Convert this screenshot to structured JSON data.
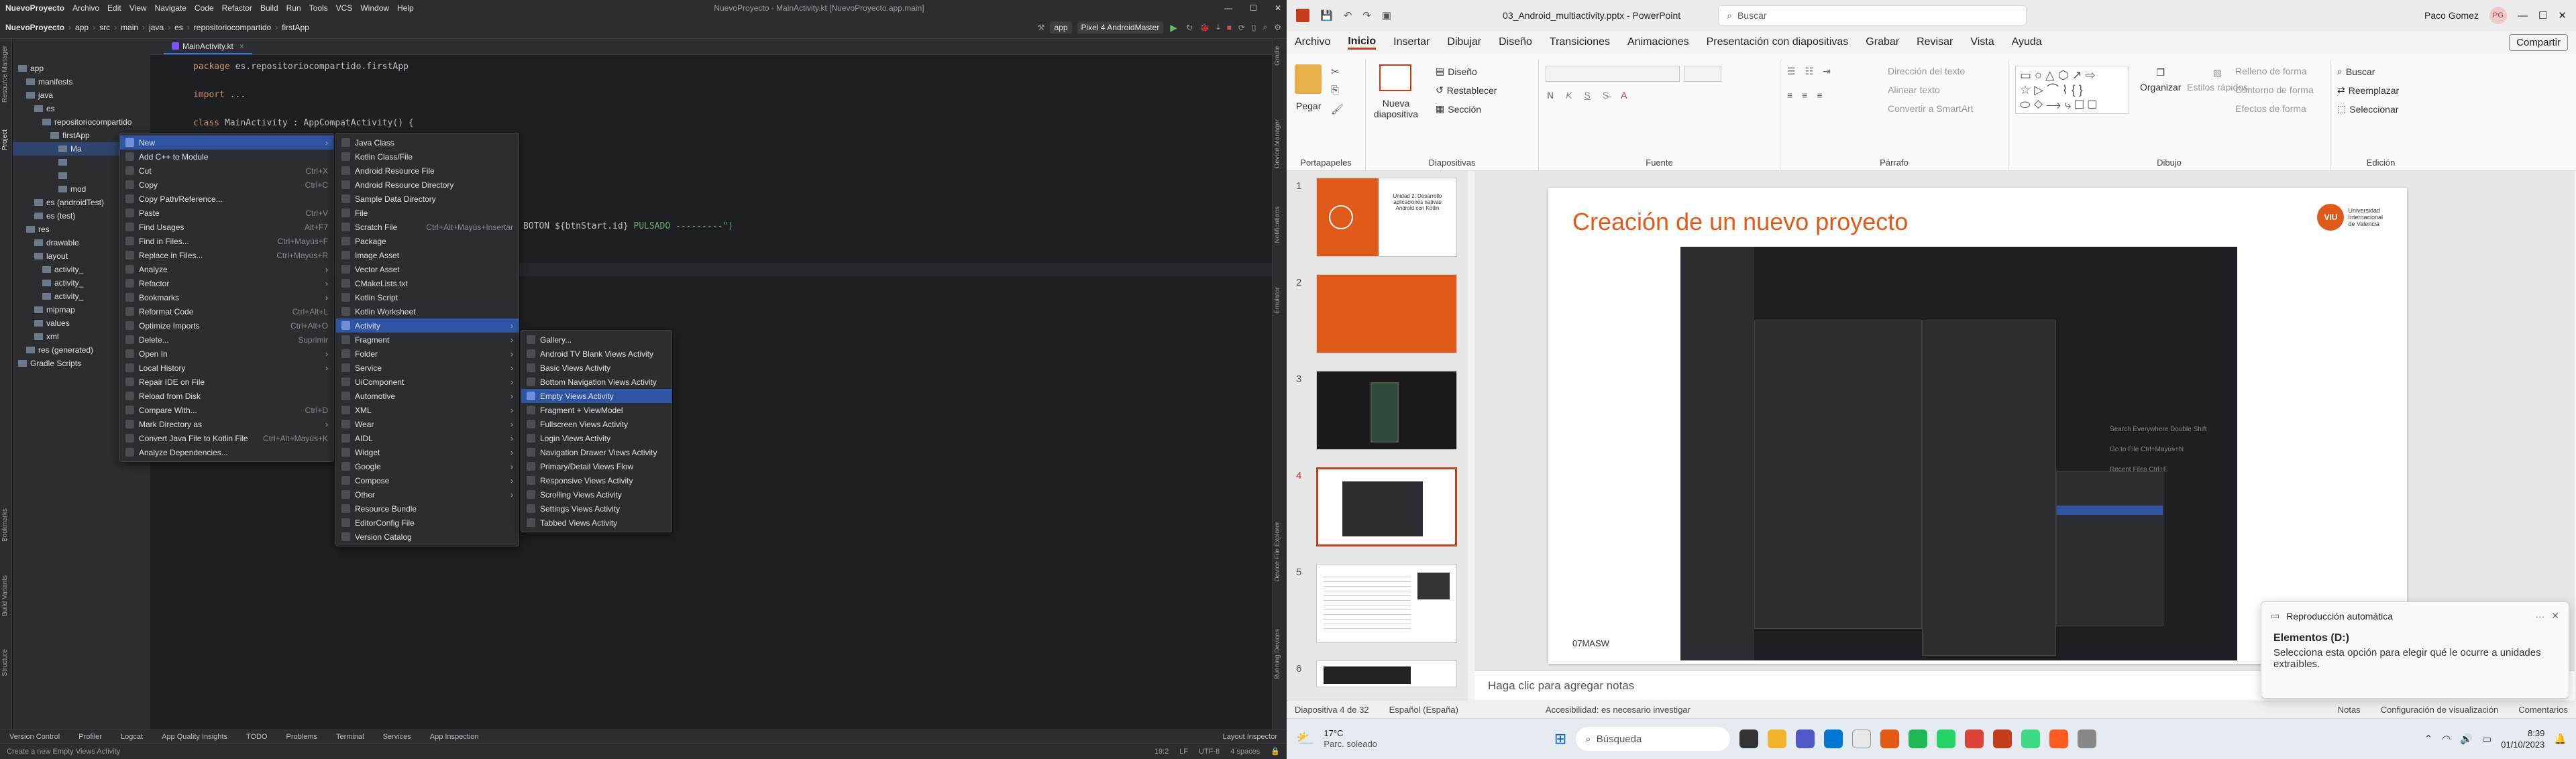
{
  "ide": {
    "title_menus": [
      "NuevoProyecto",
      "Archivo",
      "Edit",
      "View",
      "Navigate",
      "Code",
      "Refactor",
      "Build",
      "Run",
      "Tools",
      "VCS",
      "Window",
      "Help"
    ],
    "window_title": "NuevoProyecto - MainActivity.kt [NuevoProyecto.app.main]",
    "breadcrumbs": [
      "NuevoProyecto",
      "app",
      "src",
      "main",
      "java",
      "es",
      "repositoriocompartido",
      "firstApp"
    ],
    "run_config": "app",
    "device": "Pixel 4 AndroidMaster",
    "left_tool_labels": [
      "Resource Manager",
      "Project",
      "Bookmarks",
      "Build Variants",
      "Structure"
    ],
    "right_tool_labels": [
      "Gradle",
      "Device Manager",
      "Notifications",
      "Emulator",
      "Device File Explorer",
      "Running Devices"
    ],
    "tree": [
      {
        "label": "app",
        "indent": 0
      },
      {
        "label": "manifests",
        "indent": 1
      },
      {
        "label": "java",
        "indent": 1
      },
      {
        "label": "es",
        "indent": 2
      },
      {
        "label": "repositoriocompartido",
        "indent": 3
      },
      {
        "label": "firstApp",
        "indent": 4
      },
      {
        "label": "Ma",
        "indent": 5,
        "selected": true
      },
      {
        "label": "",
        "indent": 5
      },
      {
        "label": "",
        "indent": 5
      },
      {
        "label": "mod",
        "indent": 5
      },
      {
        "label": "es (androidTest)",
        "indent": 2
      },
      {
        "label": "es (test)",
        "indent": 2
      },
      {
        "label": "res",
        "indent": 1
      },
      {
        "label": "drawable",
        "indent": 2
      },
      {
        "label": "layout",
        "indent": 2
      },
      {
        "label": "activity_",
        "indent": 3
      },
      {
        "label": "activity_",
        "indent": 3
      },
      {
        "label": "activity_",
        "indent": 3
      },
      {
        "label": "mipmap",
        "indent": 2
      },
      {
        "label": "values",
        "indent": 2
      },
      {
        "label": "xml",
        "indent": 2
      },
      {
        "label": "res (generated)",
        "indent": 1
      },
      {
        "label": "Gradle Scripts",
        "indent": 0
      }
    ],
    "editor_tab": "MainActivity.kt",
    "code": {
      "line1_kw": "package",
      "line1_rest": " es.repositoriocompartido.firstApp",
      "line2_kw": "import",
      "line2_rest": " ...",
      "line3_kw": "class",
      "line3_rest": " MainActivity : AppCompatActivity() {",
      "line4_tx": "BOTON ${btnStart.id} ",
      "line4_str": "PULSADO ---------\")"
    },
    "menu1": [
      {
        "label": "New",
        "arrow": true,
        "hi": true
      },
      {
        "label": "Add C++ to Module"
      },
      {
        "label": "Cut",
        "sc": "Ctrl+X"
      },
      {
        "label": "Copy",
        "sc": "Ctrl+C"
      },
      {
        "label": "Copy Path/Reference..."
      },
      {
        "label": "Paste",
        "sc": "Ctrl+V"
      },
      {
        "label": "Find Usages",
        "sc": "Alt+F7"
      },
      {
        "label": "Find in Files...",
        "sc": "Ctrl+Mayús+F"
      },
      {
        "label": "Replace in Files...",
        "sc": "Ctrl+Mayús+R"
      },
      {
        "label": "Analyze",
        "arrow": true
      },
      {
        "label": "Refactor",
        "arrow": true
      },
      {
        "label": "Bookmarks",
        "arrow": true
      },
      {
        "label": "Reformat Code",
        "sc": "Ctrl+Alt+L"
      },
      {
        "label": "Optimize Imports",
        "sc": "Ctrl+Alt+O"
      },
      {
        "label": "Delete...",
        "sc": "Suprimir"
      },
      {
        "label": "Open In",
        "arrow": true
      },
      {
        "label": "Local History",
        "arrow": true
      },
      {
        "label": "Repair IDE on File"
      },
      {
        "label": "Reload from Disk"
      },
      {
        "label": "Compare With...",
        "sc": "Ctrl+D"
      },
      {
        "label": "Mark Directory as",
        "arrow": true
      },
      {
        "label": "Convert Java File to Kotlin File",
        "sc": "Ctrl+Alt+Mayús+K"
      },
      {
        "label": "Analyze Dependencies..."
      }
    ],
    "menu2": [
      {
        "label": "Java Class"
      },
      {
        "label": "Kotlin Class/File"
      },
      {
        "label": "Android Resource File"
      },
      {
        "label": "Android Resource Directory"
      },
      {
        "label": "Sample Data Directory"
      },
      {
        "label": "File"
      },
      {
        "label": "Scratch File",
        "sc": "Ctrl+Alt+Mayús+Insertar"
      },
      {
        "label": "Package"
      },
      {
        "label": "Image Asset"
      },
      {
        "label": "Vector Asset"
      },
      {
        "label": "CMakeLists.txt"
      },
      {
        "label": "Kotlin Script"
      },
      {
        "label": "Kotlin Worksheet"
      },
      {
        "label": "Activity",
        "arrow": true,
        "hi": true
      },
      {
        "label": "Fragment",
        "arrow": true
      },
      {
        "label": "Folder",
        "arrow": true
      },
      {
        "label": "Service",
        "arrow": true
      },
      {
        "label": "UiComponent",
        "arrow": true
      },
      {
        "label": "Automotive",
        "arrow": true
      },
      {
        "label": "XML",
        "arrow": true
      },
      {
        "label": "Wear",
        "arrow": true
      },
      {
        "label": "AIDL",
        "arrow": true
      },
      {
        "label": "Widget",
        "arrow": true
      },
      {
        "label": "Google",
        "arrow": true
      },
      {
        "label": "Compose",
        "arrow": true
      },
      {
        "label": "Other",
        "arrow": true
      },
      {
        "label": "Resource Bundle"
      },
      {
        "label": "EditorConfig File"
      },
      {
        "label": "Version Catalog"
      }
    ],
    "menu3": [
      {
        "label": "Gallery..."
      },
      {
        "label": "Android TV Blank Views Activity"
      },
      {
        "label": "Basic Views Activity"
      },
      {
        "label": "Bottom Navigation Views Activity"
      },
      {
        "label": "Empty Views Activity",
        "hi": true
      },
      {
        "label": "Fragment + ViewModel"
      },
      {
        "label": "Fullscreen Views Activity"
      },
      {
        "label": "Login Views Activity"
      },
      {
        "label": "Navigation Drawer Views Activity"
      },
      {
        "label": "Primary/Detail Views Flow"
      },
      {
        "label": "Responsive Views Activity"
      },
      {
        "label": "Scrolling Views Activity"
      },
      {
        "label": "Settings Views Activity"
      },
      {
        "label": "Tabbed Views Activity"
      }
    ],
    "tool_tabs": [
      "Version Control",
      "Profiler",
      "Logcat",
      "App Quality Insights",
      "TODO",
      "Problems",
      "Terminal",
      "Services",
      "App Inspection"
    ],
    "layout_inspector": "Layout Inspector",
    "status_hint": "Create a new Empty Views Activity",
    "status_right": [
      "19:2",
      "LF",
      "UTF-8",
      "4 spaces"
    ]
  },
  "ppt": {
    "doc_title": "03_Android_multiactivity.pptx - PowerPoint",
    "search_placeholder": "Buscar",
    "user": "Paco Gomez",
    "user_initials": "PG",
    "tabs": [
      "Archivo",
      "Inicio",
      "Insertar",
      "Dibujar",
      "Diseño",
      "Transiciones",
      "Animaciones",
      "Presentación con diapositivas",
      "Grabar",
      "Revisar",
      "Vista",
      "Ayuda"
    ],
    "active_tab": "Inicio",
    "share": "Compartir",
    "groups": [
      "Portapapeles",
      "Diapositivas",
      "Fuente",
      "Párrafo",
      "Dibujo",
      "Edición"
    ],
    "ribbon": {
      "paste": "Pegar",
      "new_slide": "Nueva diapositiva",
      "design": "Diseño",
      "reset": "Restablecer",
      "section": "Sección",
      "direction": "Dirección del texto",
      "align": "Alinear texto",
      "smartart": "Convertir a SmartArt",
      "arrange": "Organizar",
      "quick_styles": "Estilos rápidos",
      "fill": "Relleno de forma",
      "outline": "Contorno de forma",
      "effects": "Efectos de forma",
      "find": "Buscar",
      "replace": "Reemplazar",
      "select": "Seleccionar",
      "font_bold": "N",
      "font_italic": "K",
      "font_under": "S"
    },
    "slide_numbers": [
      "1",
      "2",
      "3",
      "4",
      "5",
      "6"
    ],
    "slide_title": "Creación de un nuevo proyecto",
    "slide_footer": "07MASW",
    "brand_line1": "Universidad",
    "brand_line2": "Internacional",
    "brand_line3": "de Valencia",
    "thumb1_text": "Unidad 2: Desarrollo aplicaciones nativas Android con Kotlin",
    "inner_hint1": "Search Everywhere Double Shift",
    "inner_hint2": "Go to File Ctrl+Mayús+N",
    "inner_hint3": "Recent Files Ctrl+E",
    "notes_placeholder": "Haga clic para agregar notas",
    "status": {
      "slide": "Diapositiva 4 de 32",
      "lang": "Español (España)",
      "access": "Accesibilidad: es necesario investigar",
      "notes": "Notas",
      "display": "Configuración de visualización",
      "comments": "Comentarios"
    },
    "toast": {
      "header": "Reproducción automática",
      "title": "Elementos (D:)",
      "body": "Selecciona esta opción para elegir qué le ocurre a unidades extraíbles."
    }
  },
  "taskbar": {
    "weather_temp": "17°C",
    "weather_desc": "Parc. soleado",
    "search": "Búsqueda",
    "time": "8:39",
    "date": "01/10/2023"
  },
  "colors": {
    "accent_orange": "#e05a1a",
    "ide_selection": "#2e55a3",
    "ppt_accent": "#c43e1c"
  }
}
